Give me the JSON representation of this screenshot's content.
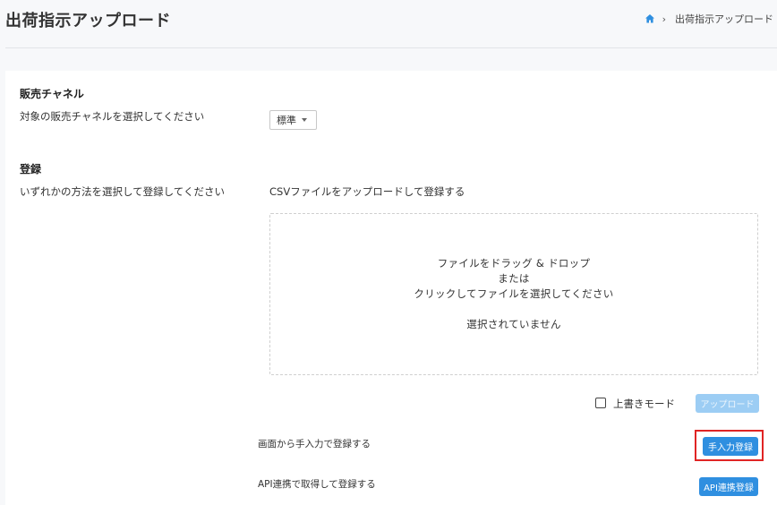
{
  "header": {
    "title": "出荷指示アップロード",
    "breadcrumb": {
      "current": "出荷指示アップロード"
    }
  },
  "sales_channel": {
    "title": "販売チャネル",
    "description": "対象の販売チャネルを選択してください",
    "selected": "標準"
  },
  "register": {
    "title": "登録",
    "description": "いずれかの方法を選択して登録してください",
    "csv_heading": "CSVファイルをアップロードして登録する",
    "dropzone": {
      "line1": "ファイルをドラッグ & ドロップ",
      "line2": "または",
      "line3": "クリックしてファイルを選択してください",
      "status": "選択されていません"
    },
    "overwrite_label": "上書きモード",
    "upload_button": "アップロード",
    "manual_text": "画面から手入力で登録する",
    "manual_button": "手入力登録",
    "api_text": "API連携で取得して登録する",
    "api_button": "API連携登録"
  },
  "colors": {
    "primary": "#2f8fe0",
    "primary_disabled": "#9ccdf4",
    "highlight": "#e02424"
  },
  "icons": {
    "breadcrumb_home": "home-icon",
    "breadcrumb_separator": "chevron-right-icon",
    "select_caret": "caret-down-icon"
  }
}
